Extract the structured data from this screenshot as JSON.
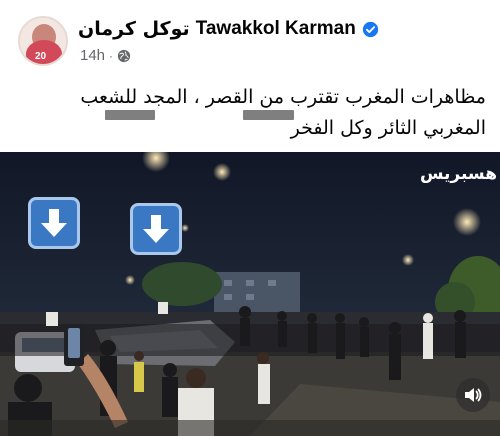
{
  "post": {
    "author_name_en": "Tawakkol Karman",
    "author_name_ar": "توكل كرمان",
    "verified": true,
    "timestamp": "14h",
    "separator": "·",
    "audience_icon": "globe-icon",
    "text": "مظاهرات المغرب تقترب من القصر ، المجد للشعب المغربي الثائر وكل الفخر",
    "avatar_badge": "20"
  },
  "video": {
    "watermark": "هسبريس",
    "overlay_icons": [
      "down-arrow-icon",
      "down-arrow-icon"
    ],
    "controls": {
      "volume_icon": "volume-icon"
    }
  },
  "colors": {
    "verified_blue": "#1877f2",
    "meta_gray": "#65676b",
    "arrow_box": "#3b78c4",
    "redaction": "#7f7f7f"
  }
}
